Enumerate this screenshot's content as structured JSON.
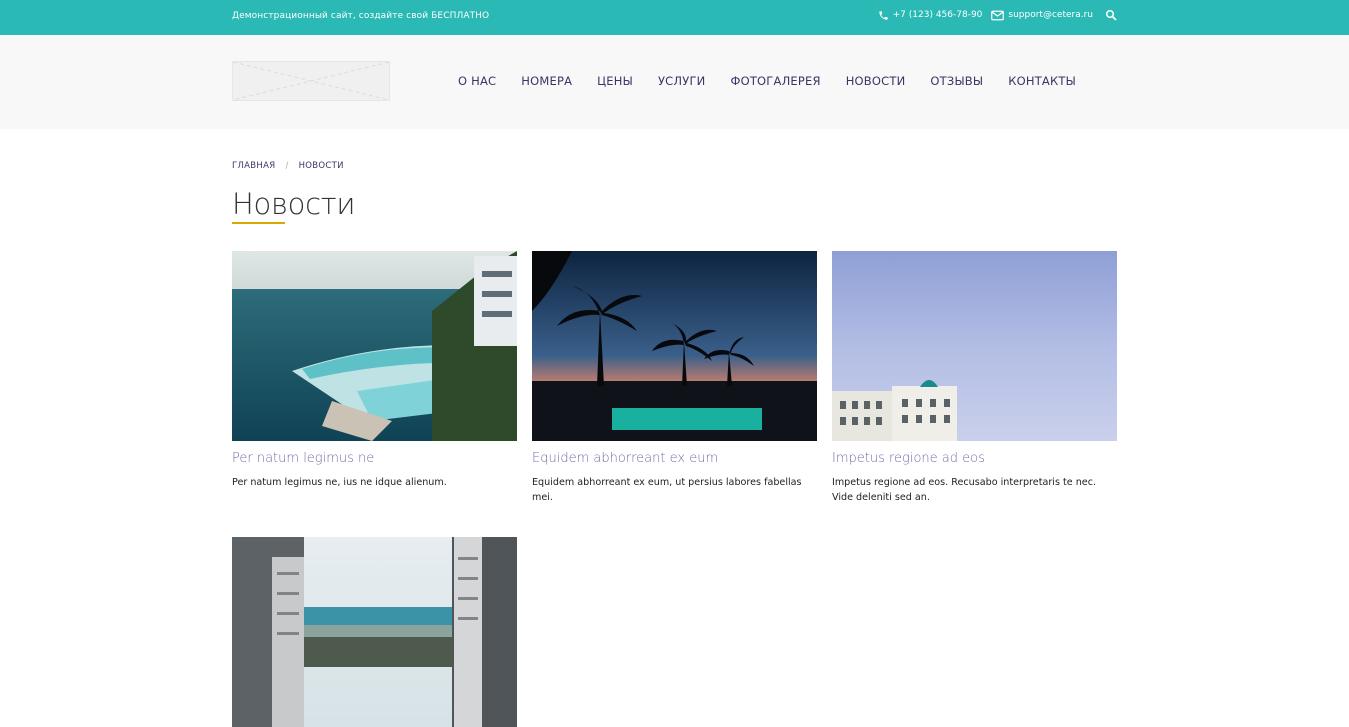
{
  "topbar": {
    "promo": "Демонстрационный сайт, создайте свой БЕСПЛАТНО",
    "phone": "+7 (123) 456-78-90",
    "email": "support@cetera.ru",
    "colors": {
      "background": "#2ab9b4",
      "text": "#ffffff"
    }
  },
  "nav": {
    "items": [
      "О НАС",
      "НОМЕРА",
      "ЦЕНЫ",
      "УСЛУГИ",
      "ФОТОГАЛЕРЕЯ",
      "НОВОСТИ",
      "ОТЗЫВЫ",
      "КОНТАКТЫ"
    ],
    "color": "#3c3466"
  },
  "breadcrumb": {
    "home": "ГЛАВНАЯ",
    "separator": "/",
    "current": "НОВОСТИ"
  },
  "page": {
    "title": "Новости",
    "accent": "#d9a700"
  },
  "news": [
    {
      "title": "Per natum legimus ne",
      "text": "Per natum legimus ne, ius ne idque alienum.",
      "image": "seaside pool hotel"
    },
    {
      "title": "Equidem abhorreant ex eum",
      "text": "Equidem abhorreant ex eum, ut persius labores fabellas mei.",
      "image": "palm trees pool at sunset"
    },
    {
      "title": "Impetus regione ad eos",
      "text": "Impetus regione ad eos. Recusabo interpretaris te nec. Vide deleniti sed an.",
      "image": "hotel building under sky"
    },
    {
      "title": "",
      "text": "",
      "image": "sea view between buildings"
    }
  ],
  "icons": [
    "phone-icon",
    "envelope-icon",
    "search-icon"
  ]
}
